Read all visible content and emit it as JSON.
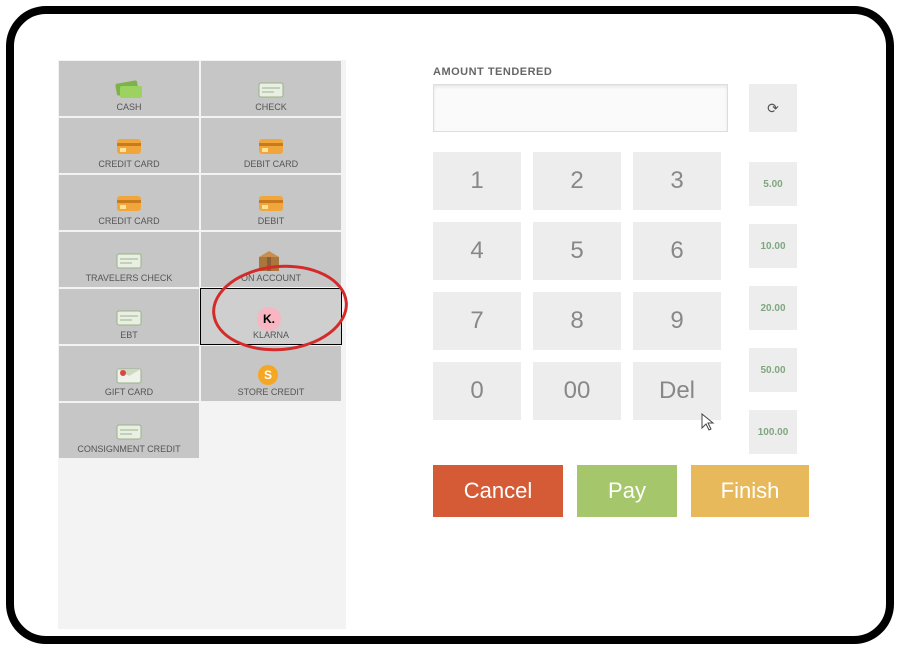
{
  "header": {
    "amount_tendered_label": "AMOUNT TENDERED",
    "amount_value": ""
  },
  "payment_types": [
    {
      "key": "cash",
      "label": "CASH",
      "icon": "cash-icon"
    },
    {
      "key": "check",
      "label": "CHECK",
      "icon": "check-icon"
    },
    {
      "key": "credit1",
      "label": "CREDIT CARD",
      "icon": "credit-card-icon"
    },
    {
      "key": "debit_card",
      "label": "DEBIT CARD",
      "icon": "debit-card-icon"
    },
    {
      "key": "credit2",
      "label": "CREDIT CARD",
      "icon": "credit-card-icon"
    },
    {
      "key": "debit",
      "label": "DEBIT",
      "icon": "debit-icon"
    },
    {
      "key": "travelers",
      "label": "TRAVELERS CHECK",
      "icon": "travelers-check-icon"
    },
    {
      "key": "on_account",
      "label": "ON ACCOUNT",
      "icon": "box-icon"
    },
    {
      "key": "ebt",
      "label": "EBT",
      "icon": "ebt-icon"
    },
    {
      "key": "klarna",
      "label": "KLARNA",
      "icon": "klarna-icon",
      "selected": true,
      "circled": true
    },
    {
      "key": "gift_card",
      "label": "GIFT CARD",
      "icon": "gift-card-icon"
    },
    {
      "key": "store_credit",
      "label": "STORE CREDIT",
      "icon": "coin-icon"
    },
    {
      "key": "consignment",
      "label": "CONSIGNMENT CREDIT",
      "icon": "consignment-icon"
    }
  ],
  "keypad": {
    "rows": [
      [
        "1",
        "2",
        "3"
      ],
      [
        "4",
        "5",
        "6"
      ],
      [
        "7",
        "8",
        "9"
      ],
      [
        "0",
        "00",
        "Del"
      ]
    ]
  },
  "quick_amounts": [
    "5.00",
    "10.00",
    "20.00",
    "50.00",
    "100.00"
  ],
  "actions": {
    "cancel": "Cancel",
    "pay": "Pay",
    "finish": "Finish"
  },
  "refresh_glyph": "⟳"
}
